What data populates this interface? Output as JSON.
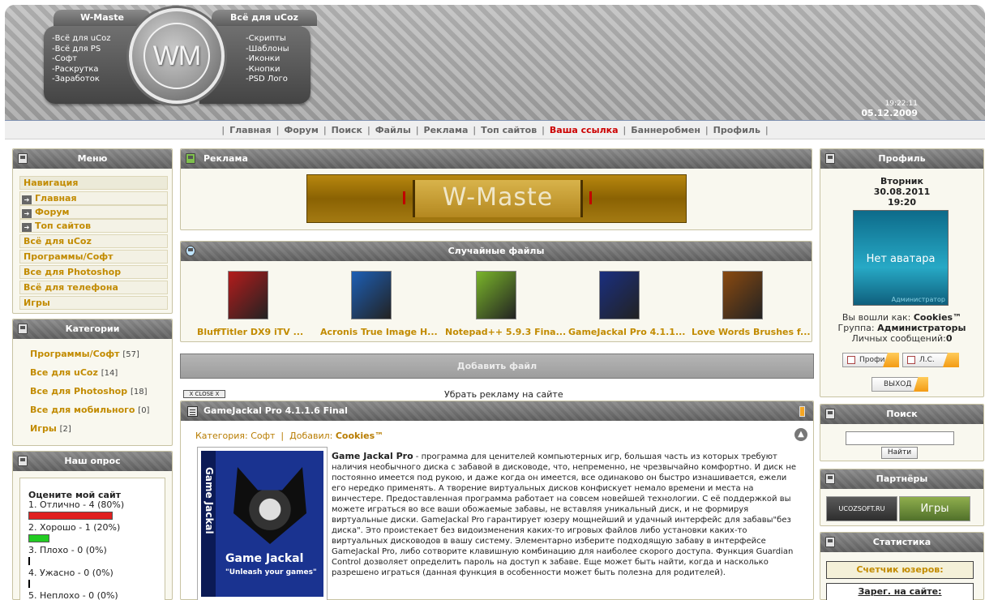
{
  "header": {
    "tab_left": "W-Maste",
    "tab_right": "Всё для uCoz",
    "logo": "WM",
    "links_left": [
      "-Всё для uCoz",
      "-Всё для PS",
      "-Софт",
      "-Раскрутка",
      "-Заработок"
    ],
    "links_right": [
      "-Скрипты",
      "-Шаблоны",
      "-Иконки",
      "-Кнопки",
      "-PSD Лого"
    ],
    "time": "19:22:11",
    "date": "05.12.2009"
  },
  "nav": {
    "items": [
      "Главная",
      "Форум",
      "Поиск",
      "Файлы",
      "Реклама",
      "Топ сайтов",
      "Ваша ссылка",
      "Баннеробмен",
      "Профиль"
    ],
    "sep": "|"
  },
  "menu": {
    "title": "Меню",
    "nav_header": "Навигация",
    "sub_items": [
      "Главная",
      "Форум",
      "Топ сайтов"
    ],
    "items": [
      "Всё для uCoz",
      "Программы/Софт",
      "Все для Photoshop",
      "Всё для телефона",
      "Игры"
    ]
  },
  "categories": {
    "title": "Категории",
    "items": [
      {
        "name": "Программы/Софт",
        "count": "[57]"
      },
      {
        "name": "Все для uCoz",
        "count": "[14]"
      },
      {
        "name": "Все для Photoshop",
        "count": "[18]"
      },
      {
        "name": "Все для мобильного",
        "count": "[0]"
      },
      {
        "name": "Игры",
        "count": "[2]"
      }
    ]
  },
  "poll": {
    "title": "Наш опрос",
    "question": "Оцените мой сайт",
    "options": [
      {
        "label": "1. Отлично - 4 (80%)",
        "percent": 80,
        "color": "#e02020"
      },
      {
        "label": "2. Хорошо - 1 (20%)",
        "percent": 20,
        "color": "#22cc22"
      },
      {
        "label": "3. Плохо - 0 (0%)",
        "percent": 0,
        "color": "#000000"
      },
      {
        "label": "4. Ужасно - 0 (0%)",
        "percent": 0,
        "color": "#000000"
      },
      {
        "label": "5. Неплохо - 0 (0%)",
        "percent": 0,
        "color": "#000000"
      }
    ]
  },
  "ads": {
    "title": "Реклама",
    "banner_text": "W-Maste"
  },
  "files": {
    "title": "Случайные файлы",
    "items": [
      {
        "name": "BluffTitler DX9 iTV ...",
        "color": "#b31c1c"
      },
      {
        "name": "Acronis True Image H...",
        "color": "#1d5fb5"
      },
      {
        "name": "Notepad++ 5.9.3 Fina...",
        "color": "#7ab52a"
      },
      {
        "name": "GameJackal Pro 4.1.1...",
        "color": "#1a2f80"
      },
      {
        "name": "Love Words Brushes f...",
        "color": "#8a4a10"
      }
    ]
  },
  "add_file": "Добавить файл",
  "close_label": "X CLOSE X",
  "remove_ad": "Убрать рекламу на сайте",
  "article": {
    "title": "GameJackal Pro 4.1.1.6 Final",
    "category_label": "Категория:",
    "category": "Софт",
    "added_label": "Добавил:",
    "author": "Cookies™",
    "image_spine": "Game Jackal",
    "image_title": "Game Jackal",
    "image_sub": "\"Unleash your games\"",
    "lead": "Game Jackal Pro",
    "text": " - программа для ценителей компьютерных игр, большая часть из которых требуют наличия необычного диска с забавой в дисководе, что, непременно, не чрезвычайно комфортно. И диск не постоянно имеется под рукою, и даже когда он имеется, все одинаково он быстро изнашивается, ежели его нередко применять. А творение виртуальных дисков конфискует немало времени и места на винчестере. Предоставленная программа работает на совсем новейшей технологии. С её поддержкой вы можете играться во все ваши обожаемые забавы, не вставляя уникальный диск, и не формируя виртуальные диски. GameJackal Pro гарантирует юзеру мощнейший и удачный интерфейс для забавы\"без диска\". Это проистекает без видоизменения каких-то игровых файлов либо установки каких-то виртуальных дисководов в вашу систему. Элементарно изберите подходящую забаву в интерфейсе GameJackal Pro, либо сотворите клавишную комбинацию для наиболее скорого доступа. Функция Guardian Control дозволяет определить пароль на доступ к забаве. Еще может быть найти, когда и насколько разрешено играться (данная функция в особенности может быть полезна для родителей)."
  },
  "profile": {
    "title": "Профиль",
    "day": "Вторник",
    "date": "30.08.2011",
    "time": "19:20",
    "avatar_text": "Нет аватара",
    "avatar_role": "Администратор",
    "logged_label": "Вы вошли как:",
    "user": "Cookies™",
    "group_label": "Группа:",
    "group": "Администраторы",
    "messages_label": "Личных сообщений:",
    "messages": "0",
    "profile_btn": "Профиль",
    "pm_btn": "Л.С.",
    "logout_btn": "ВЫХОД"
  },
  "search": {
    "title": "Поиск",
    "button": "Найти",
    "value": ""
  },
  "partners": {
    "title": "Партнёры",
    "p1": "UCOZSOFT.RU",
    "p2": "Игры"
  },
  "stats": {
    "title": "Статистика",
    "counter": "Счетчик юзеров:",
    "online": "Зарег. на сайте:"
  }
}
